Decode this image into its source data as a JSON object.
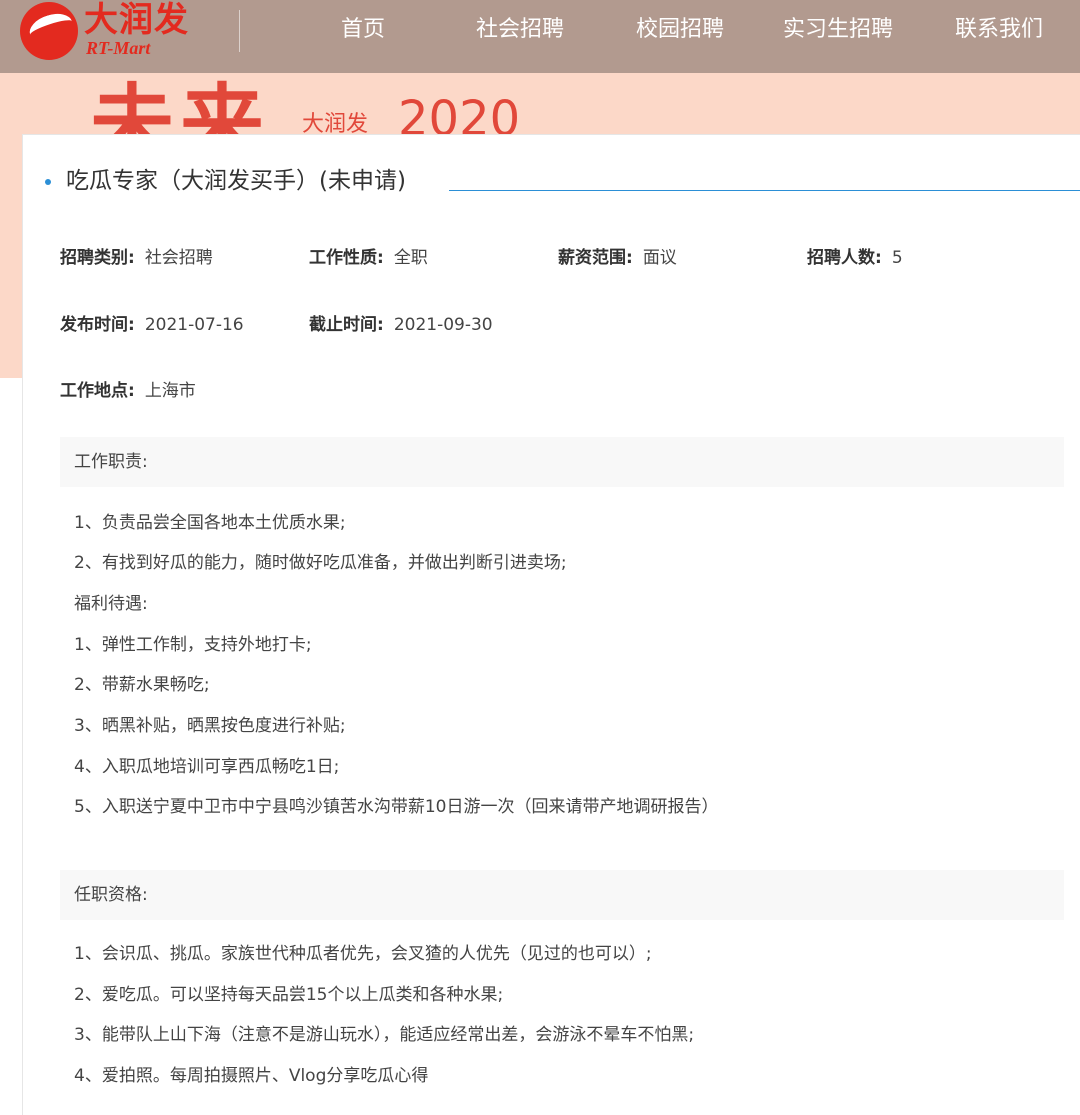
{
  "header": {
    "logo_cn": "大润发",
    "logo_en": "RT-Mart",
    "nav": [
      "首页",
      "社会招聘",
      "校园招聘",
      "实习生招聘",
      "联系我们"
    ]
  },
  "banner": {
    "big": "未来",
    "small": "大润发",
    "year": "2020"
  },
  "job": {
    "title": "吃瓜专家（大润发买手）(未申请)",
    "meta": {
      "category": {
        "label": "招聘类别:",
        "value": "社会招聘"
      },
      "nature": {
        "label": "工作性质:",
        "value": "全职"
      },
      "salary": {
        "label": "薪资范围:",
        "value": "面议"
      },
      "count": {
        "label": "招聘人数:",
        "value": "5"
      },
      "publish": {
        "label": "发布时间:",
        "value": "2021-07-16"
      },
      "deadline": {
        "label": "截止时间:",
        "value": "2021-09-30"
      },
      "location": {
        "label": "工作地点:",
        "value": "上海市"
      }
    },
    "duties_title": "工作职责:",
    "duties": [
      "1、负责品尝全国各地本土优质水果;",
      "2、有找到好瓜的能力，随时做好吃瓜准备，并做出判断引进卖场;"
    ],
    "benefits_title": "福利待遇:",
    "benefits": [
      "1、弹性工作制，支持外地打卡;",
      "2、带薪水果畅吃;",
      "3、晒黑补贴，晒黑按色度进行补贴;",
      "4、入职瓜地培训可享西瓜畅吃1日;",
      "5、入职送宁夏中卫市中宁县鸣沙镇苦水沟带薪10日游一次（回来请带产地调研报告）"
    ],
    "qual_title": "任职资格:",
    "qualifications": [
      "1、会识瓜、挑瓜。家族世代种瓜者优先，会叉猹的人优先（见过的也可以）;",
      "2、爱吃瓜。可以坚持每天品尝15个以上瓜类和各种水果;",
      "3、能带队上山下海（注意不是游山玩水），能适应经常出差，会游泳不晕车不怕黑;",
      "4、爱拍照。每周拍摄照片、Vlog分享吃瓜心得"
    ]
  },
  "colors": {
    "header_bg": "#b29a8f",
    "brand_red": "#e32a1f",
    "banner_bg": "#fcd8c8",
    "accent_blue": "#2b8fd6"
  }
}
